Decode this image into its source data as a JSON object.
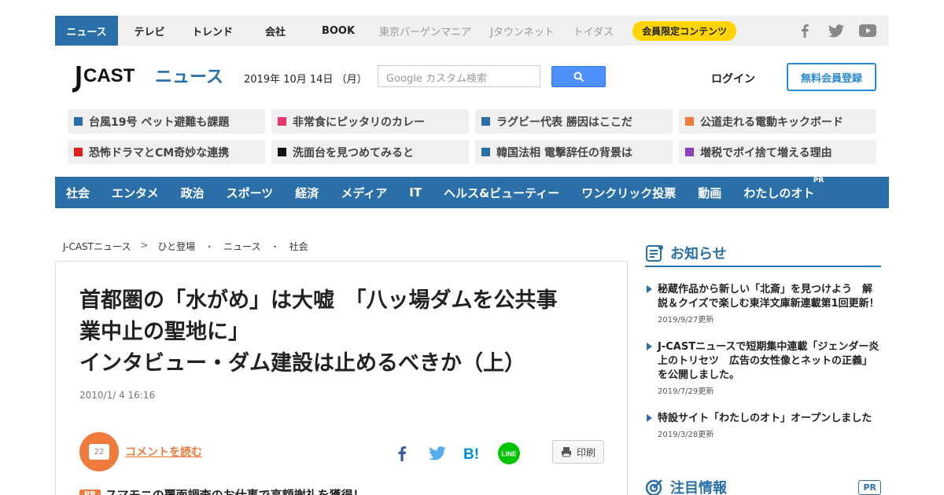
{
  "topnav": {
    "tabs": [
      "ニュース",
      "テレビ",
      "トレンド",
      "会社",
      "BOOK"
    ],
    "external": [
      "東京バーゲンマニア",
      "Jタウンネット",
      "トイダス"
    ],
    "member_label": "会員限定コンテンツ",
    "social_icons": [
      "facebook-icon",
      "twitter-icon",
      "youtube-icon"
    ]
  },
  "header": {
    "logo_text": "J CAST",
    "logo_sub": "ニュース",
    "date": "2019年 10月 14日 （月）",
    "search_placeholder": "Google カスタム検索",
    "login_label": "ログイン",
    "register_label": "無料会員登録"
  },
  "trends": [
    {
      "label": "台風19号 ペット避難も課題",
      "color": "#2a6fa8"
    },
    {
      "label": "非常食にピッタリのカレー",
      "color": "#e8386d"
    },
    {
      "label": "ラグビー代表 勝因はここだ",
      "color": "#2a6fa8"
    },
    {
      "label": "公道走れる電動キックボード",
      "color": "#f07a3c"
    },
    {
      "label": "恐怖ドラマとCM奇妙な連携",
      "color": "#e02020"
    },
    {
      "label": "洗面台を見つめてみると",
      "color": "#111111"
    },
    {
      "label": "韓国法相 電撃辞任の背景は",
      "color": "#2a6fa8"
    },
    {
      "label": "増税でポイ捨て増える理由",
      "color": "#8a44b8"
    }
  ],
  "categories": [
    "社会",
    "エンタメ",
    "政治",
    "スポーツ",
    "経済",
    "メディア",
    "IT",
    "ヘルス&ビューティー",
    "ワンクリック投票",
    "動画",
    "わたしのオト"
  ],
  "category_pr": "PR",
  "breadcrumb": [
    "J-CASTニュース",
    ">",
    "ひと登場",
    "・",
    "ニュース",
    "・",
    "社会"
  ],
  "article": {
    "headline": [
      "首都圏の「水がめ」は大嘘　「八ッ場ダムを公共事",
      "業中止の聖地に」",
      "インタビュー・ダム建設は止めるべきか（上）"
    ],
    "date": "2010/1/ 4 16:16",
    "comment_count": "22",
    "comment_label": "コメントを読む",
    "print_label": "印刷",
    "pr_tag": "PR",
    "pr_text": "スマモニの覆面調査のお仕事で高額謝礼を獲得！"
  },
  "sidebar": {
    "news_title": "お知らせ",
    "news": [
      {
        "text": "秘蔵作品から新しい「北斎」を見つけよう　解説＆クイズで楽しむ東洋文庫新連載第1回更新！",
        "date": "2019/9/27更新"
      },
      {
        "text": "J-CASTニュースで短期集中連載「ジェンダー炎上のトリセツ　広告の女性像とネットの正義」を公開しました。",
        "date": "2019/7/29更新"
      },
      {
        "text": "特設サイト「わたしのオト」オープンしました",
        "date": "2019/3/28更新"
      }
    ],
    "focus_title": "注目情報",
    "focus_pr": "PR"
  }
}
